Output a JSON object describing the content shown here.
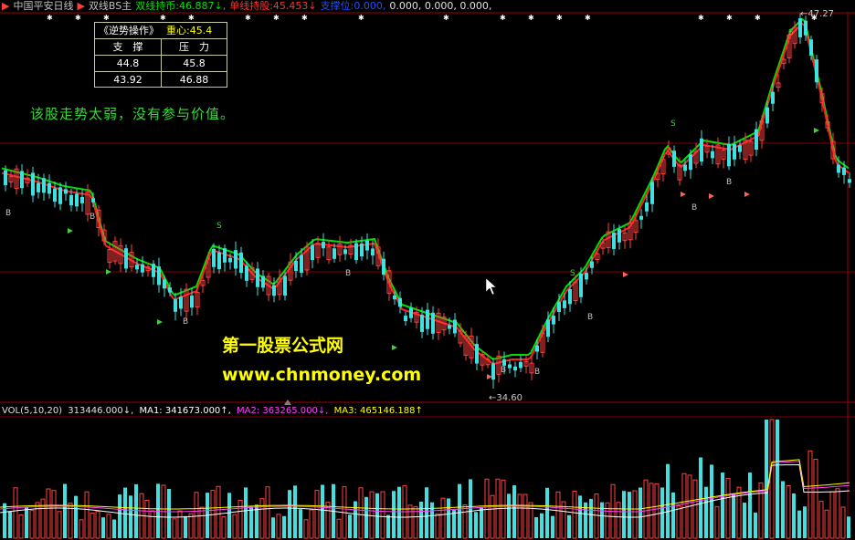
{
  "header": {
    "stock_title": "中国平安日线",
    "indicator_name": "双线BS主",
    "dual_hold_label": "双线持币:",
    "dual_hold_value": "46.887↓,",
    "single_hold_label": "单线持股:",
    "single_hold_value": "45.453↓",
    "support_label": "支撑位:",
    "support_value": "0.000,",
    "extra_values": "0.000, 0.000, 0.000,"
  },
  "sr_table": {
    "title": "《逆势操作》",
    "center_label": "重心:45.4",
    "col_support": "支　撑",
    "col_pressure": "压　力",
    "rows": [
      {
        "support": "44.8",
        "pressure": "45.8"
      },
      {
        "support": "43.92",
        "pressure": "46.88"
      }
    ]
  },
  "comment": "该股走势太弱，没有参与价值。",
  "watermark": {
    "line1": "第一股票公式网",
    "line2": "www.chnmoney.com"
  },
  "price_marks": {
    "low": "←34.60",
    "high": "←47.27"
  },
  "volume_header": {
    "name": "VOL(5,10,20)",
    "vol": "313446.000↓,",
    "ma1": "MA1: 341673.000↑,",
    "ma2": "MA2: 363265.000↓,",
    "ma3": "MA3: 465146.188↑"
  },
  "colors": {
    "up": "#ff4040",
    "down": "#40e0e0",
    "green_line": "#00e000",
    "red_line": "#ff2020",
    "grid": "#800000",
    "ma1": "#ffffff",
    "ma2": "#ff40ff",
    "ma3": "#ffff00"
  },
  "signals": {
    "sell_letter": "S",
    "buy_letter": "B"
  }
}
